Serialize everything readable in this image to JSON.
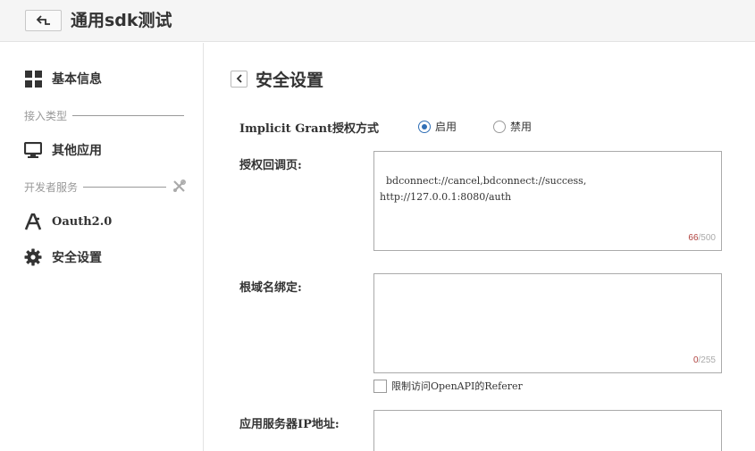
{
  "header": {
    "title": "通用sdk测试"
  },
  "sidebar": {
    "items": [
      {
        "label": "基本信息",
        "icon": "grid-icon"
      },
      {
        "label": "其他应用",
        "icon": "monitor-icon"
      },
      {
        "label": "Oauth2.0",
        "icon": "oauth-icon"
      },
      {
        "label": "安全设置",
        "icon": "gear-icon"
      }
    ],
    "sections": [
      {
        "label": "接入类型"
      },
      {
        "label": "开发者服务"
      }
    ]
  },
  "main": {
    "title": "安全设置",
    "implicit_grant": {
      "label": "Implicit Grant授权方式",
      "options": [
        {
          "label": "启用",
          "checked": true
        },
        {
          "label": "禁用",
          "checked": false
        }
      ]
    },
    "redirect": {
      "label": "授权回调页:",
      "value": "bdconnect://cancel,bdconnect://success,\nhttp://127.0.0.1:8080/auth",
      "count": "66",
      "max": "/500"
    },
    "root_domain": {
      "label": "根域名绑定:",
      "value": "",
      "count": "0",
      "max": "/255"
    },
    "referer_checkbox": {
      "label": "限制访问OpenAPI的Referer",
      "checked": false
    },
    "server_ip": {
      "label": "应用服务器IP地址:",
      "value": ""
    }
  },
  "colors": {
    "accent": "#2f6fb6",
    "counter_current": "#b0413e"
  }
}
